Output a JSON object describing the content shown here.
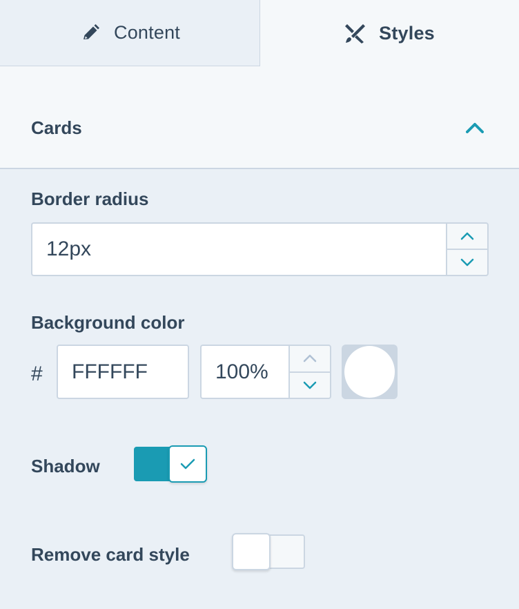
{
  "tabs": [
    {
      "label": "Content",
      "icon": "pencil-icon",
      "active": false
    },
    {
      "label": "Styles",
      "icon": "brush-icon",
      "active": true
    }
  ],
  "section": {
    "title": "Cards",
    "expanded": true
  },
  "border_radius": {
    "label": "Border radius",
    "value": "12px"
  },
  "background_color": {
    "label": "Background color",
    "prefix": "#",
    "hex": "FFFFFF",
    "opacity": "100%",
    "swatch_color": "#FFFFFF"
  },
  "shadow": {
    "label": "Shadow",
    "enabled": true
  },
  "remove_card_style": {
    "label": "Remove card style",
    "enabled": false
  },
  "colors": {
    "accent": "#1a9bb3",
    "text": "#33475b",
    "border": "#cbd6e2",
    "panel": "#eaf0f6"
  }
}
